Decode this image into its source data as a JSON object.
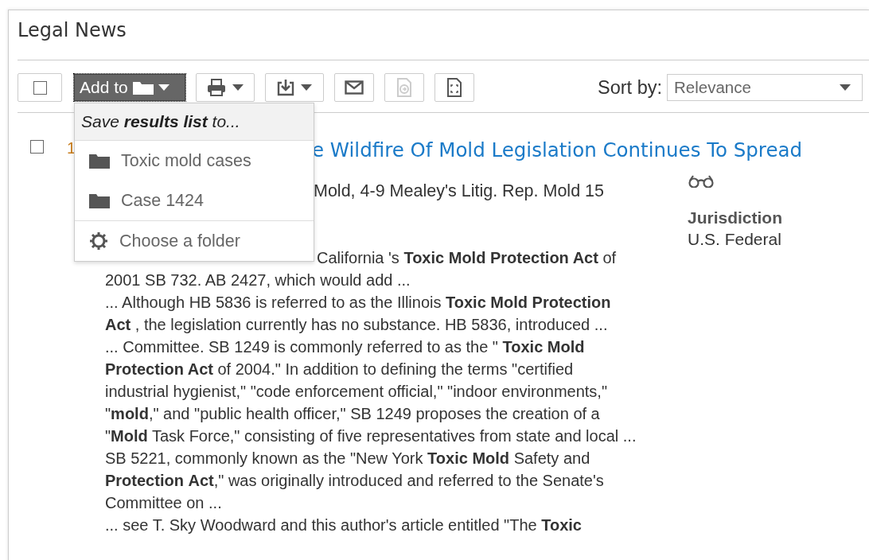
{
  "page": {
    "title": "Legal News"
  },
  "toolbar": {
    "select_all": {
      "checked": false
    },
    "add_to": {
      "label": "Add to",
      "expanded": true
    },
    "buttons": [
      {
        "kind": "print",
        "dropdown": true,
        "disabled": false
      },
      {
        "kind": "download",
        "dropdown": true,
        "disabled": false
      },
      {
        "kind": "email",
        "dropdown": false,
        "disabled": false
      },
      {
        "kind": "send-doc",
        "dropdown": false,
        "disabled": true
      },
      {
        "kind": "full-doc",
        "dropdown": false,
        "disabled": false
      }
    ],
    "sort": {
      "label": "Sort by:",
      "value": "Relevance"
    }
  },
  "menu": {
    "header": "Save **results list** to...",
    "items": [
      {
        "kind": "folder",
        "label": "Toxic mold cases"
      },
      {
        "kind": "folder",
        "label": "Case 1424"
      },
      {
        "kind": "choose",
        "label": "Choose a folder"
      }
    ]
  },
  "results": [
    {
      "checked": false,
      "number": "1",
      "title": "e Wildfire Of Mold Legislation Continues To Spread",
      "citation": "Mold, 4-9 Mealey's Litig. Rep. Mold 15",
      "jurisdiction_label": "Jurisdiction",
      "jurisdiction": "U.S. Federal",
      "snippets": [
        "California 's **Toxic Mold Protection Act** of 2001 SB 732. AB 2427, which would add ...",
        "... Although HB 5836 is referred to as the Illinois **Toxic Mold Protection Act** , the legislation currently has no substance. HB 5836, introduced ...",
        "... Committee. SB 1249 is commonly referred to as the \" **Toxic Mold Protection Act** of 2004.\" In addition to defining the terms \"certified industrial hygienist,\" \"code enforcement official,\" \"indoor environments,\" \"**mold**,\" and \"public health officer,\" SB 1249 proposes the creation of a \"**Mold** Task Force,\" consisting of five representatives from state and local ...",
        "SB 5221, commonly known as the \"New York **Toxic** **Mold** Safety and **Protection** **Act**,\" was originally introduced and referred to the Senate's Committee on ...",
        "... see T. Sky Woodward and this author's article entitled \"The **Toxic**"
      ]
    }
  ]
}
